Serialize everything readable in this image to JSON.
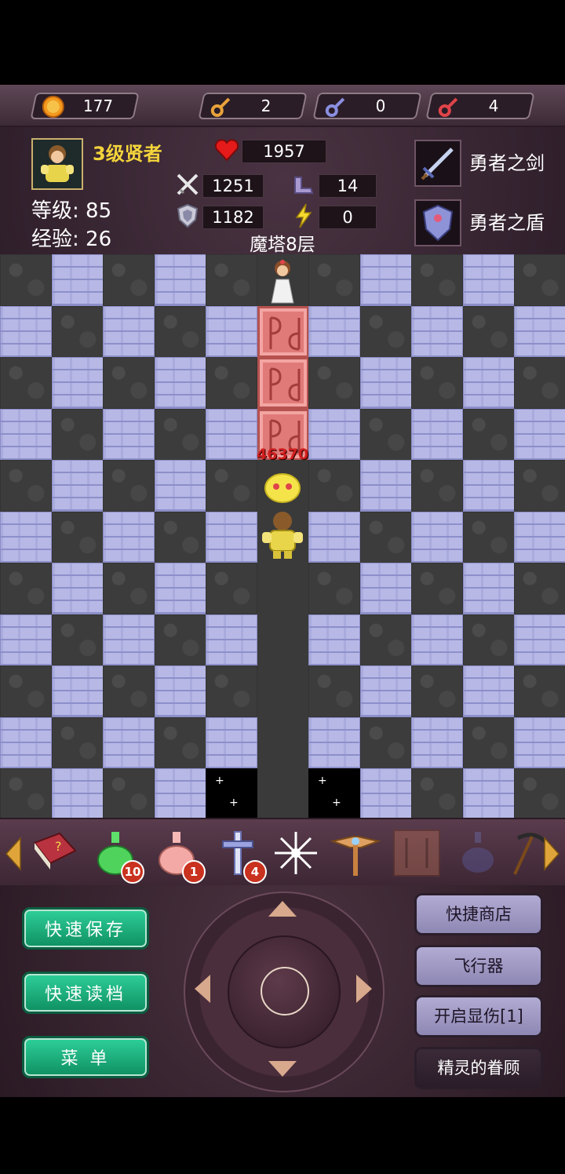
{
  "resources": {
    "gold": "177",
    "yellow_keys": "2",
    "blue_keys": "0",
    "red_keys": "4"
  },
  "hero": {
    "title": "3级贤者",
    "level_label": "等级:",
    "level": "85",
    "exp_label": "经验:",
    "exp": "26",
    "hp": "1957",
    "attack": "1251",
    "defense": "1182",
    "agility": "14",
    "magic": "0"
  },
  "floor": "魔塔8层",
  "equipment": {
    "weapon": "勇者之剑",
    "shield": "勇者之盾"
  },
  "map": {
    "damage_estimate": "46370"
  },
  "items": [
    {
      "name": "monster-manual",
      "count": ""
    },
    {
      "name": "green-potion",
      "count": "10"
    },
    {
      "name": "pink-potion",
      "count": "1"
    },
    {
      "name": "cross-sword",
      "count": "4"
    },
    {
      "name": "snowflake",
      "count": ""
    },
    {
      "name": "fly-wand",
      "count": ""
    },
    {
      "name": "red-door-item",
      "count": ""
    },
    {
      "name": "dark-potion",
      "count": ""
    },
    {
      "name": "pickaxe",
      "count": ""
    }
  ],
  "buttons": {
    "quick_save": "快速保存",
    "quick_load": "快速读档",
    "menu": "菜 单",
    "quick_shop": "快捷商店",
    "flyer": "飞行器",
    "show_damage": "开启显伤[1]",
    "fairy_blessing": "精灵的眷顾"
  },
  "colors": {
    "title_yellow": "#f3d43b",
    "damage_red": "#d01f1f",
    "green_button": "#1fb07e",
    "purple_button": "#a49ec8"
  }
}
